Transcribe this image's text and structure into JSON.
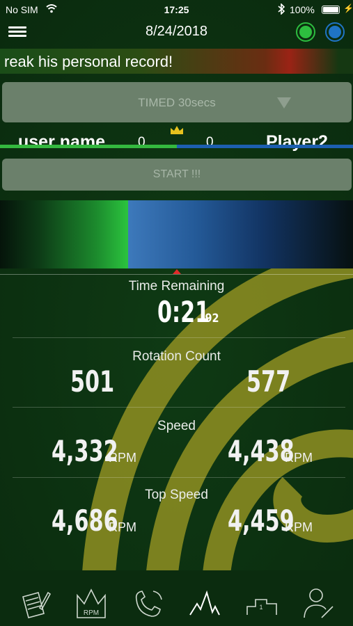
{
  "status_bar": {
    "carrier": "No SIM",
    "time": "17:25",
    "battery_percent": "100%",
    "wifi_icon": "wifi-icon",
    "bluetooth_icon": "bluetooth-icon"
  },
  "nav": {
    "date": "8/24/2018",
    "player1_color": "#2dbd3f",
    "player2_color": "#1f74c5"
  },
  "ticker": {
    "text": "reak his personal record!"
  },
  "mode_select": {
    "selected": "TIMED 30secs"
  },
  "players": {
    "p1_name": "user name",
    "p1_score": "0",
    "p2_name": "Player2",
    "p2_score": "0",
    "leader_icon": "crown-icon"
  },
  "start_button": {
    "label": "START !!!"
  },
  "progress": {
    "p1_fraction": 0.363
  },
  "stats": {
    "time_remaining": {
      "label": "Time Remaining",
      "value": "0:21",
      "fraction": ".92"
    },
    "rotation_count": {
      "label": "Rotation Count",
      "p1": "501",
      "p2": "577"
    },
    "speed": {
      "label": "Speed",
      "p1": "4,332",
      "p2": "4,438",
      "unit": "RPM"
    },
    "top_speed": {
      "label": "Top Speed",
      "p1": "4,686",
      "p2": "4,459",
      "unit": "RPM"
    }
  },
  "tabs": [
    {
      "icon": "notepad-icon"
    },
    {
      "icon": "crown-rpm-icon",
      "label": "RPM"
    },
    {
      "icon": "versus-icon"
    },
    {
      "icon": "graph-icon"
    },
    {
      "icon": "podium-icon",
      "label": "1"
    },
    {
      "icon": "profile-icon"
    }
  ]
}
